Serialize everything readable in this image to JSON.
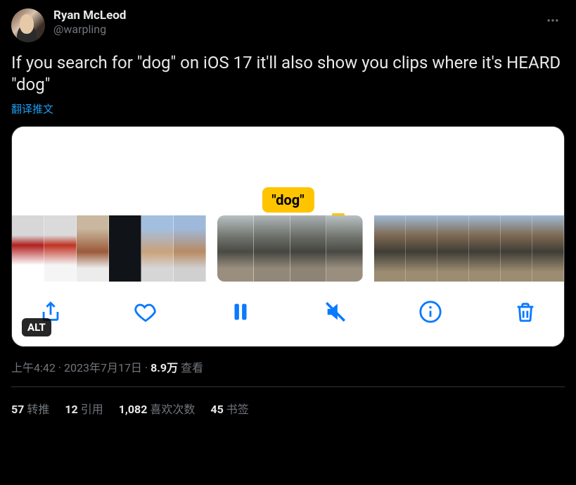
{
  "author": {
    "display_name": "Ryan McLeod",
    "handle": "@warpling"
  },
  "tweet_text": "If you search for \"dog\" on iOS 17 it'll also show you clips where it's HEARD \"dog\"",
  "translate_label": "翻译推文",
  "media": {
    "badge_text": "\"dog\"",
    "alt_label": "ALT",
    "toolbar_icons": [
      "share",
      "heart",
      "pause",
      "mute",
      "info",
      "trash"
    ]
  },
  "meta": {
    "time": "上午4:42",
    "date": "2023年7月17日",
    "views_count": "8.9万",
    "views_label": "查看"
  },
  "stats": {
    "retweets": {
      "count": "57",
      "label": "转推"
    },
    "quotes": {
      "count": "12",
      "label": "引用"
    },
    "likes": {
      "count": "1,082",
      "label": "喜欢次数"
    },
    "bookmarks": {
      "count": "45",
      "label": "书签"
    }
  }
}
